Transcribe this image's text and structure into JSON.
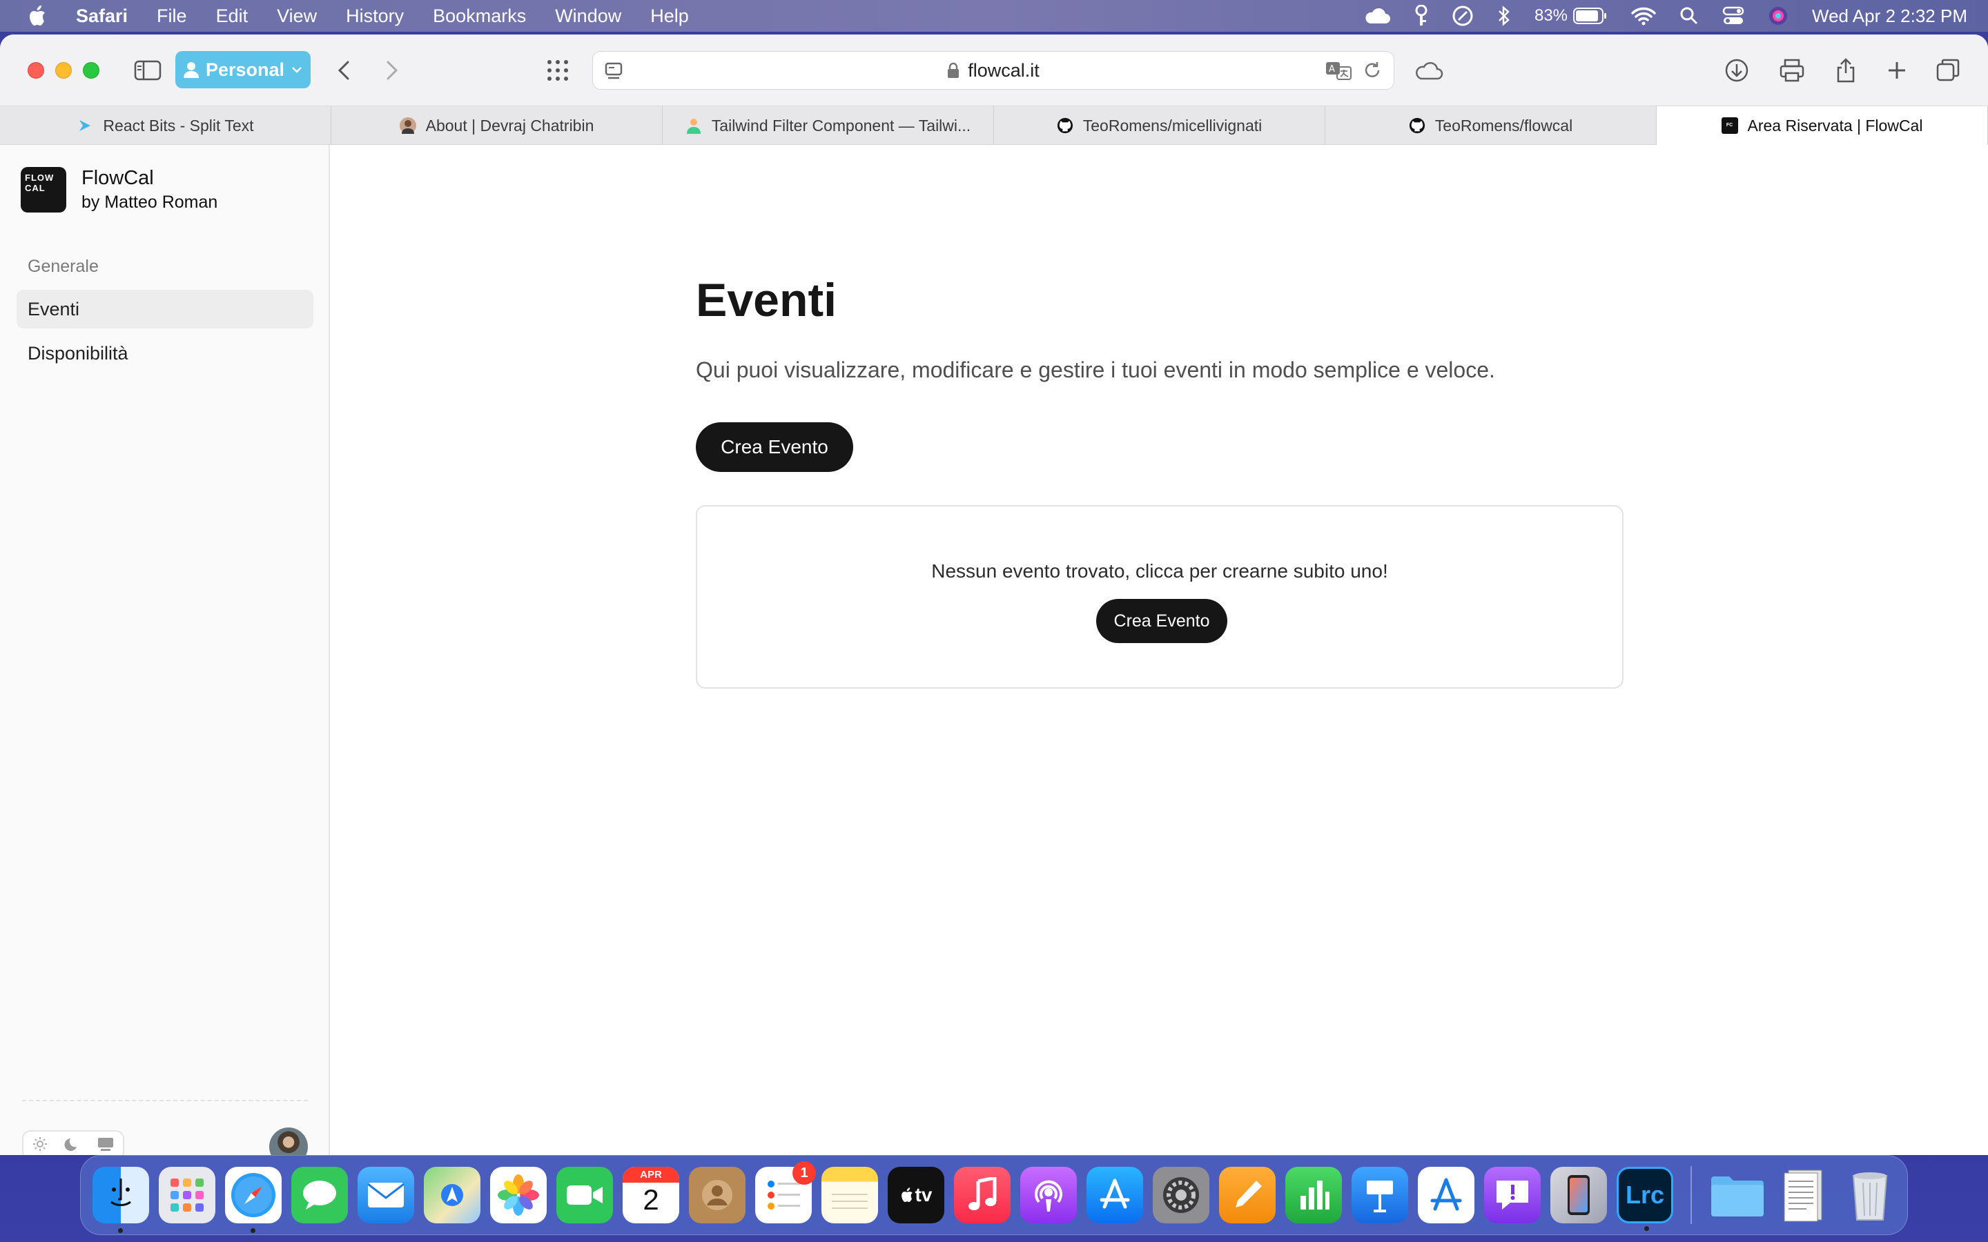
{
  "menubar": {
    "app_name": "Safari",
    "items": [
      "File",
      "Edit",
      "View",
      "History",
      "Bookmarks",
      "Window",
      "Help"
    ],
    "battery": "83%",
    "datetime": "Wed Apr 2  2:32 PM"
  },
  "toolbar": {
    "profile_label": "Personal",
    "url": "flowcal.it"
  },
  "tabs": [
    {
      "label": "React Bits - Split Text",
      "favicon": "react-icon",
      "color": "#3db8e8"
    },
    {
      "label": "About | Devraj Chatribin",
      "favicon": "person-icon",
      "color": "#8a5a3c"
    },
    {
      "label": "Tailwind Filter Component — Tailwi...",
      "favicon": "tailwind-icon",
      "color": "#f06fa8"
    },
    {
      "label": "TeoRomens/micellivignati",
      "favicon": "github-icon",
      "color": "#111111"
    },
    {
      "label": "TeoRomens/flowcal",
      "favicon": "github-icon",
      "color": "#111111"
    },
    {
      "label": "Area Riservata | FlowCal",
      "favicon": "flowcal-icon",
      "color": "#111111"
    }
  ],
  "sidebar": {
    "brand_logo_text": "FLOW CAL",
    "brand_title": "FlowCal",
    "brand_subtitle": "by Matteo Roman",
    "group_label": "Generale",
    "items": [
      {
        "label": "Eventi",
        "active": true
      },
      {
        "label": "Disponibilità",
        "active": false
      }
    ]
  },
  "main": {
    "title": "Eventi",
    "description": "Qui puoi visualizzare, modificare e gestire i tuoi eventi in modo semplice e veloce.",
    "create_button": "Crea Evento",
    "empty_state": {
      "text": "Nessun evento trovato, clicca per crearne subito uno!",
      "button": "Crea Evento"
    }
  },
  "dock": {
    "calendar_month": "APR",
    "calendar_day": "2",
    "reminders_badge": "1",
    "tv_label": "tv",
    "lrc_label": "Lrc"
  },
  "colors": {
    "accent_profile": "#5ec3e8",
    "button_dark": "#161616"
  }
}
